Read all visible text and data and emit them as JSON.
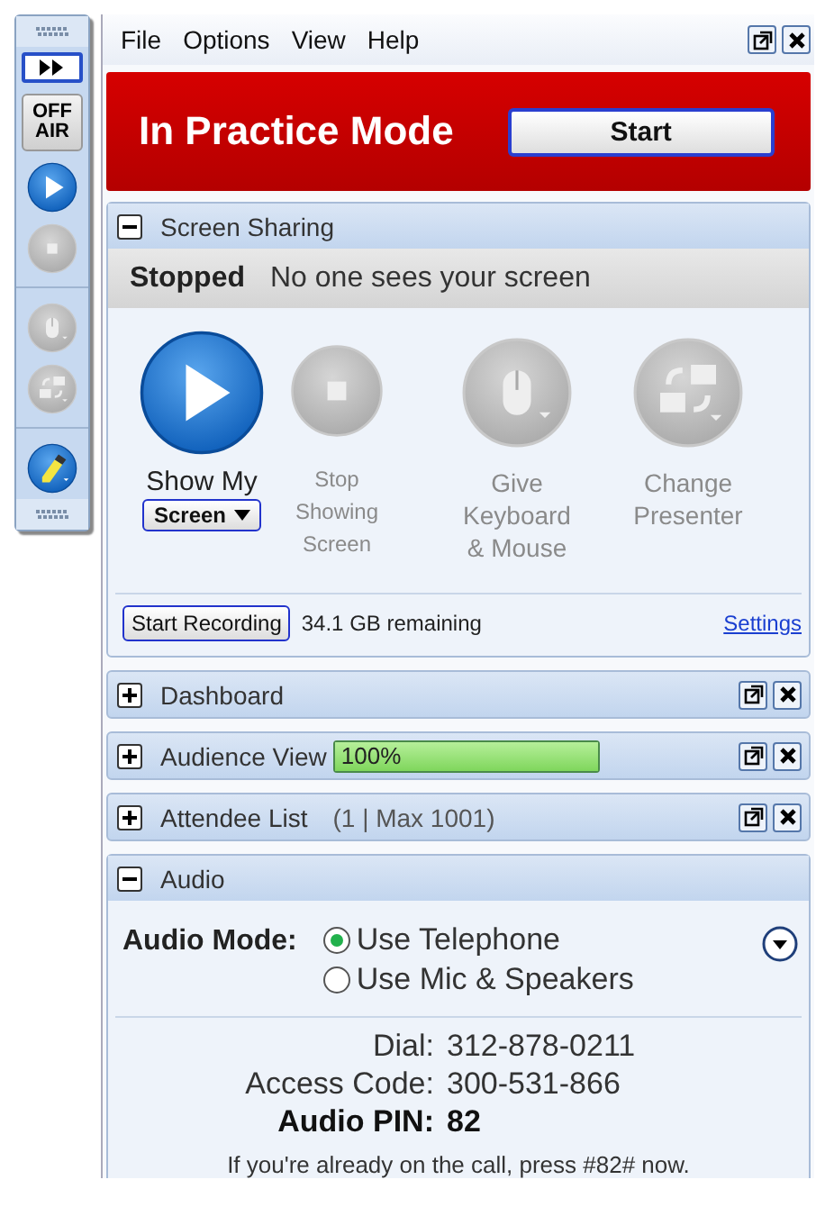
{
  "toolbar": [
    {
      "kind": "grip"
    },
    {
      "kind": "expand"
    },
    {
      "kind": "off_air",
      "label": "OFF AIR"
    },
    {
      "kind": "play",
      "disabled": false
    },
    {
      "kind": "stop",
      "disabled": true
    },
    {
      "kind": "mouse",
      "disabled": true
    },
    {
      "kind": "presenter",
      "disabled": true
    },
    {
      "kind": "highlighter",
      "disabled": false
    },
    {
      "kind": "grip"
    }
  ],
  "menu": [
    "File",
    "Options",
    "View",
    "Help"
  ],
  "banner": {
    "title": "In Practice Mode",
    "button": "Start"
  },
  "screen_sharing": {
    "title": "Screen Sharing",
    "expanded": true,
    "status": "Stopped",
    "status_text": "No one sees your screen",
    "actions": [
      {
        "kind": "play",
        "label": "Show My",
        "dropdown": "Screen",
        "disabled": false
      },
      {
        "kind": "stop",
        "label": "Stop Showing Screen",
        "disabled": true
      },
      {
        "kind": "mouse",
        "label": "Give Keyboard & Mouse",
        "disabled": true
      },
      {
        "kind": "presenter",
        "label": "Change Presenter",
        "disabled": true
      }
    ],
    "record_button": "Start Recording",
    "remaining": "34.1 GB remaining",
    "settings_link": "Settings"
  },
  "panels": [
    {
      "title": "Dashboard",
      "expanded": false
    },
    {
      "title": "Audience View",
      "expanded": false,
      "progress": {
        "text": "100%",
        "level": 1
      }
    },
    {
      "title": "Attendee List",
      "expanded": false,
      "count": "(1 | Max 1001)"
    }
  ],
  "audio": {
    "title": "Audio",
    "expanded": true,
    "mode_label": "Audio Mode:",
    "options": [
      {
        "label": "Use Telephone",
        "selected": true
      },
      {
        "label": "Use Mic & Speakers",
        "selected": false
      }
    ],
    "info": [
      {
        "label": "Dial:",
        "value": "312-878-0211",
        "bold": false
      },
      {
        "label": "Access Code:",
        "value": "300-531-866",
        "bold": false
      },
      {
        "label": "Audio PIN:",
        "value": "82",
        "bold": true
      }
    ],
    "note": "If you're already on the call, press #82# now."
  }
}
